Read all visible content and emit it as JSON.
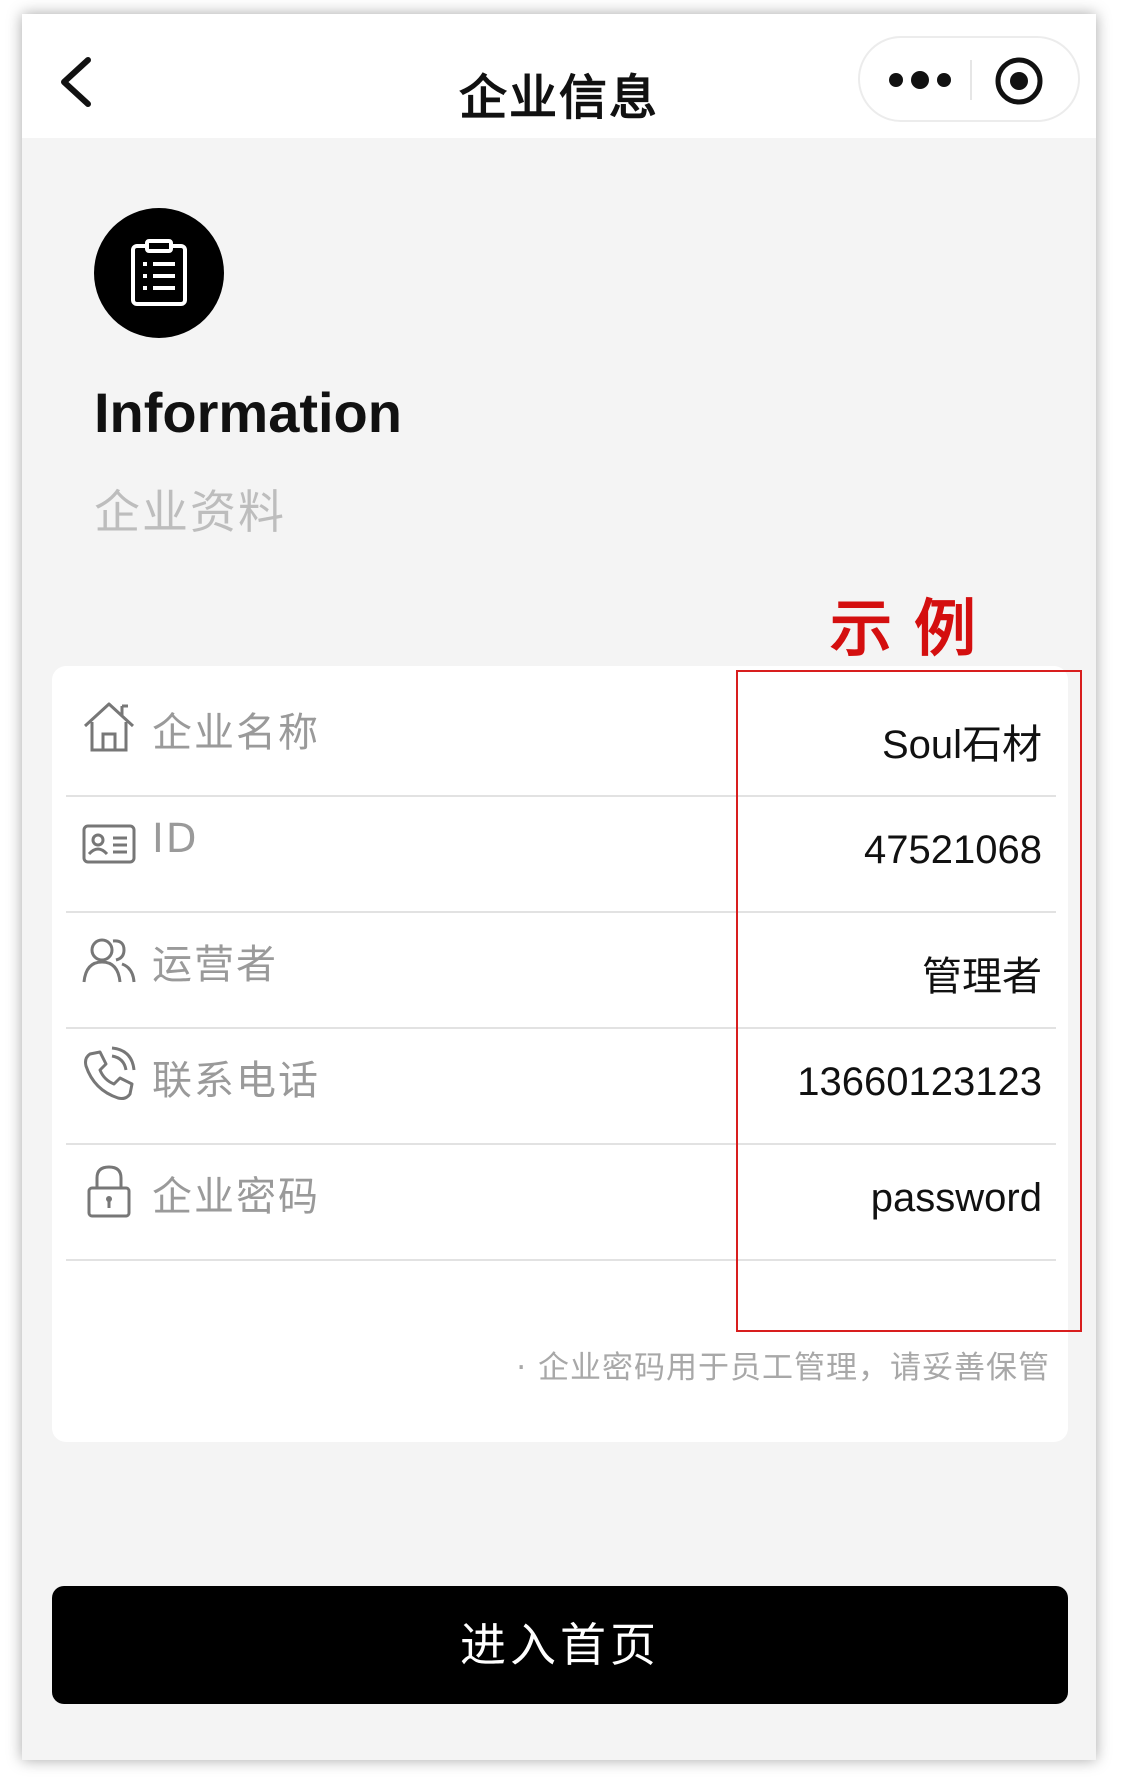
{
  "nav": {
    "title": "企业信息"
  },
  "header": {
    "title": "Information",
    "subtitle": "企业资料",
    "example_label": "示例"
  },
  "fields": [
    {
      "icon": "home-icon",
      "label": "企业名称",
      "value": "Soul石材"
    },
    {
      "icon": "id-card-icon",
      "label": "ID",
      "value": "47521068"
    },
    {
      "icon": "users-icon",
      "label": "运营者",
      "value": "管理者"
    },
    {
      "icon": "phone-icon",
      "label": "联系电话",
      "value": "13660123123"
    },
    {
      "icon": "lock-icon",
      "label": "企业密码",
      "value": "password"
    }
  ],
  "note": "· 企业密码用于员工管理，请妥善保管",
  "primary_button": {
    "label": "进入首页"
  },
  "colors": {
    "accent_red": "#d40f0f",
    "button_bg": "#000000",
    "page_bg": "#f4f4f4"
  }
}
